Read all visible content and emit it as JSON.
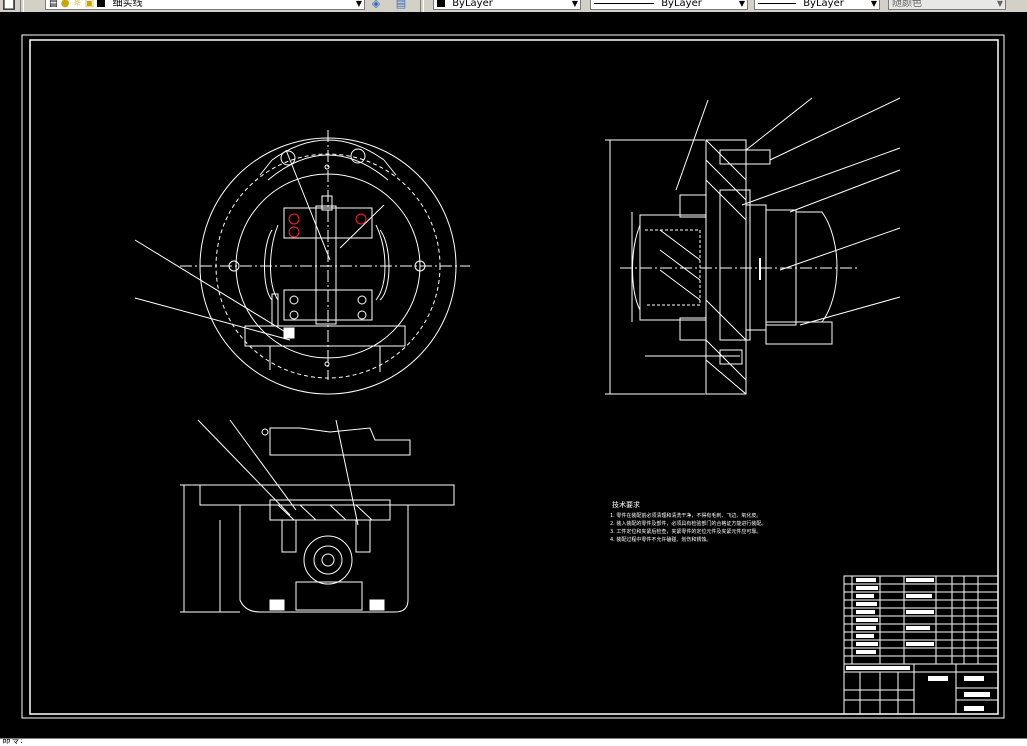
{
  "toolbar": {
    "layer_name": "细实线",
    "color_combo": "ByLayer",
    "linetype_combo": "ByLayer",
    "lineweight_combo": "ByLayer",
    "plotstyle_combo": "随颜色"
  },
  "drawing": {
    "tech_title": "技术要求",
    "tech_notes": [
      "1. 零件在装配前必须清理和清洗干净，不得有毛刺、飞边、氧化皮。",
      "2. 装入装配的零件及部件，必须具有检验部门的合格证方能进行装配。",
      "3. 工件定位和夹紧后检查，夹紧零件的定位元件及夹紧元件应可靠。",
      "4. 装配过程中零件不允许磕碰、划伤和锈蚀。"
    ]
  },
  "colors": {
    "background": "#000000",
    "lines": "#ffffff",
    "hole_accent": "#ff2020",
    "toolbar": "#d4d0c8"
  },
  "icons": [
    "layer-manager-icon",
    "layer-state-icon",
    "lightbulb-icon",
    "sun-icon",
    "lock-icon",
    "layer-previous-icon",
    "match-layer-icon"
  ],
  "command_line": {
    "prompt": "命令:"
  }
}
